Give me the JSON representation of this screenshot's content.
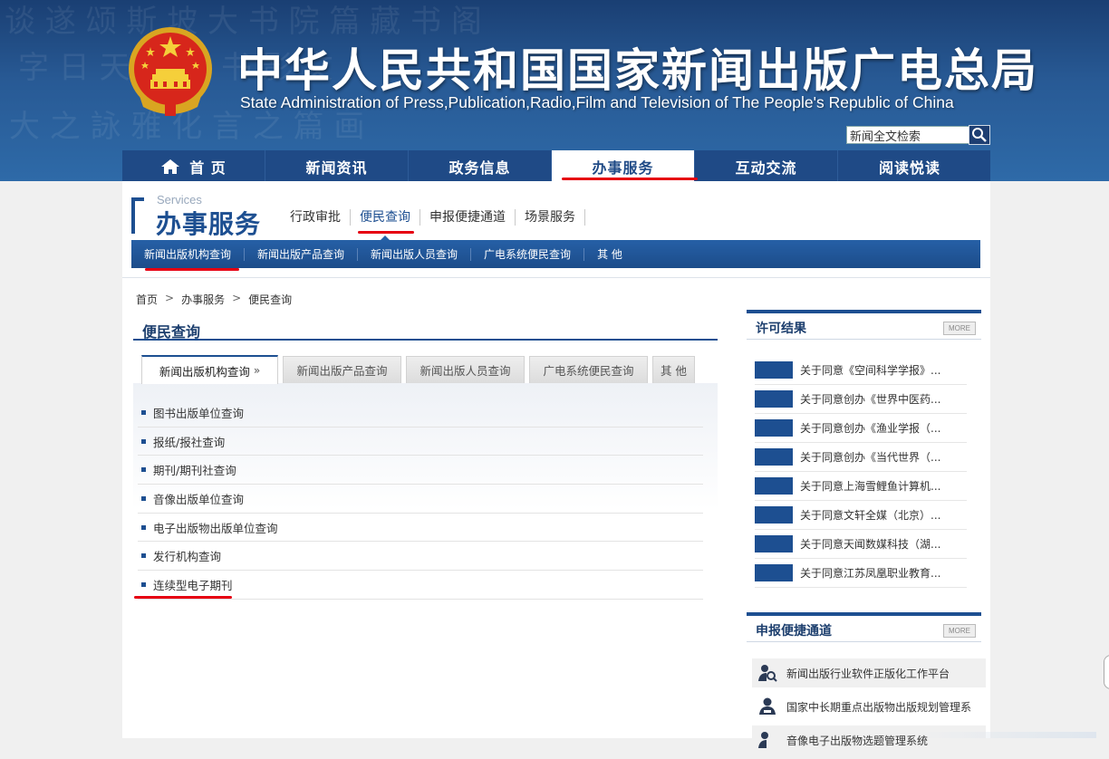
{
  "header": {
    "title": "中华人民共和国国家新闻出版广电总局",
    "subtitle": "State Administration of Press,Publication,Radio,Film and Television of The People's Republic of China",
    "search_placeholder": "新闻全文检索",
    "search_icon": "search-icon",
    "emblem_icon": "national-emblem-icon"
  },
  "nav": {
    "items": [
      {
        "label": "首 页",
        "icon": "home-icon"
      },
      {
        "label": "新闻资讯"
      },
      {
        "label": "政务信息"
      },
      {
        "label": "办事服务",
        "active": true
      },
      {
        "label": "互动交流"
      },
      {
        "label": "阅读悦读"
      }
    ]
  },
  "services": {
    "en": "Services",
    "cn": "办事服务",
    "subnav": [
      "行政审批",
      "便民查询",
      "申报便捷通道",
      "场景服务"
    ],
    "subnav_active": "便民查询",
    "bluebar": [
      "新闻出版机构查询",
      "新闻出版产品查询",
      "新闻出版人员查询",
      "广电系统便民查询",
      "其 他"
    ]
  },
  "breadcrumb": [
    "首页",
    ">",
    "办事服务",
    ">",
    "便民查询"
  ],
  "section": {
    "title": "便民查询",
    "tabs": [
      {
        "label": "新闻出版机构查询",
        "active": true,
        "arrow": "»"
      },
      {
        "label": "新闻出版产品查询"
      },
      {
        "label": "新闻出版人员查询"
      },
      {
        "label": "广电系统便民查询"
      },
      {
        "label": "其 他"
      }
    ],
    "list": [
      "图书出版单位查询",
      "报纸/报社查询",
      "期刊/期刊社查询",
      "音像出版单位查询",
      "电子出版物出版单位查询",
      "发行机构查询",
      "连续型电子期刊"
    ]
  },
  "sidebar": {
    "license": {
      "title": "许可结果",
      "more": "MORE",
      "items": [
        "关于同意《空间科学学报》...",
        "关于同意创办《世界中医药...",
        "关于同意创办《渔业学报（...",
        "关于同意创办《当代世界（...",
        "关于同意上海雪鲤鱼计算机...",
        "关于同意文轩全媒（北京）...",
        "关于同意天闻数媒科技（湖...",
        "关于同意江苏凤凰职业教育..."
      ]
    },
    "report": {
      "title": "申报便捷通道",
      "more": "MORE",
      "items": [
        {
          "label": "新闻出版行业软件正版化工作平台",
          "icon": "user-search-icon"
        },
        {
          "label": "国家中长期重点出版物出版规划管理系",
          "icon": "user-manage-icon"
        },
        {
          "label": "音像电子出版物选题管理系统",
          "icon": "user-search-icon"
        }
      ]
    }
  },
  "colors": {
    "header_blue": "#285a95",
    "nav_blue": "#1f4a86",
    "accent_blue": "#1d4f91",
    "annotation_red": "#e60012"
  }
}
